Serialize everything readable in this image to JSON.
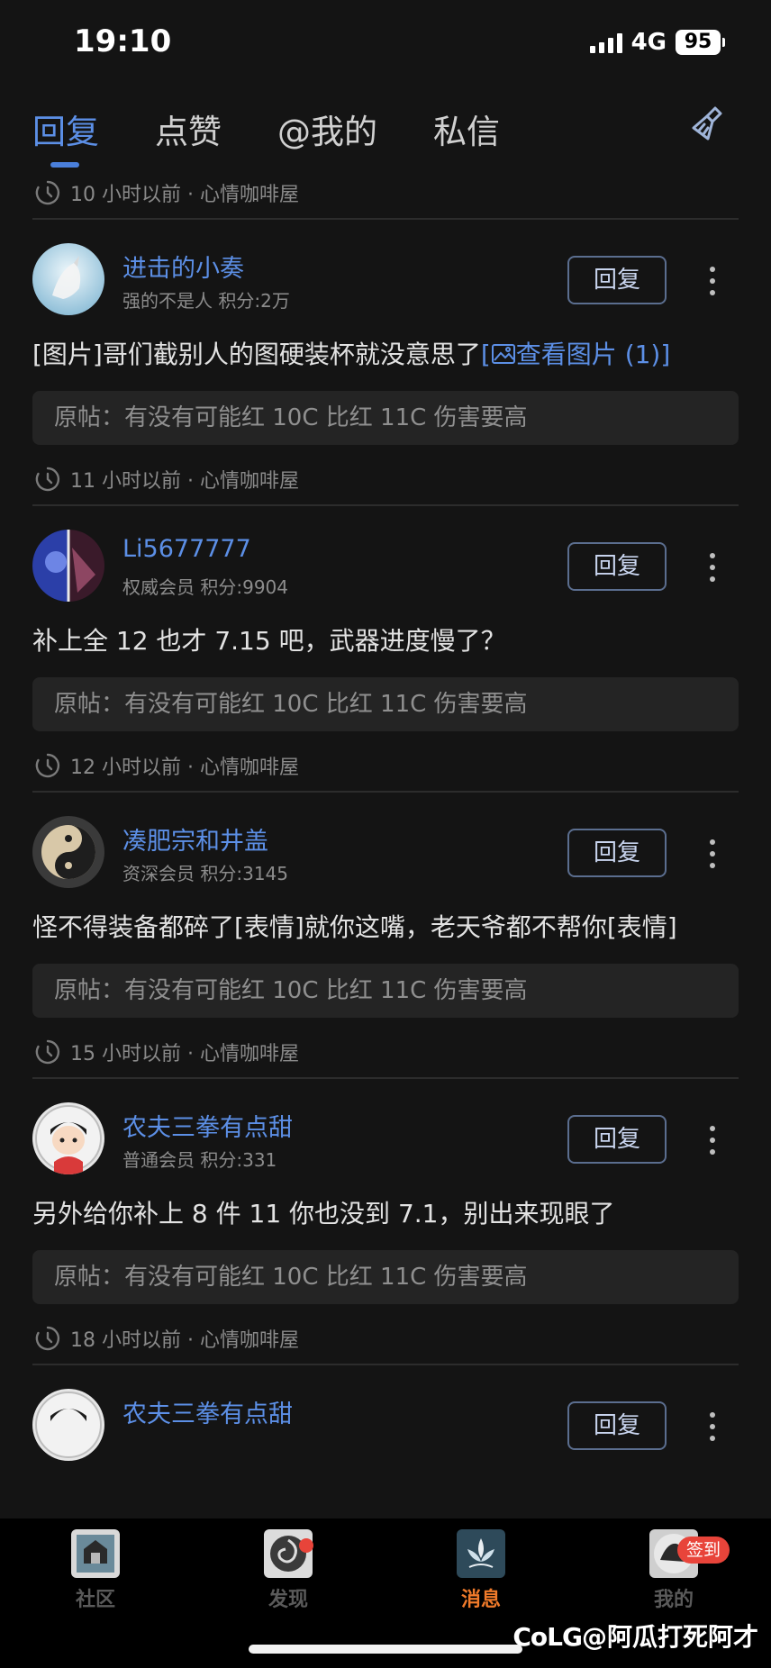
{
  "status_bar": {
    "time": "19:10",
    "network": "4G",
    "battery": "95"
  },
  "tabs": [
    {
      "label": "回复",
      "active": true
    },
    {
      "label": "点赞",
      "active": false
    },
    {
      "label": "@我的",
      "active": false
    },
    {
      "label": "私信",
      "active": false
    }
  ],
  "top_meta": {
    "time": "10 小时以前 · 心情咖啡屋"
  },
  "items": [
    {
      "username": "进击的小奏",
      "user_meta": "强的不是人 积分:2万",
      "reply_label": "回复",
      "content": "[图片]哥们截别人的图硬装杯就没意思了",
      "view_images": "查看图片 (1)]",
      "view_images_prefix": "[",
      "original": "原帖：有没有可能红 10C 比红 11C 伤害要高",
      "meta": "11 小时以前 · 心情咖啡屋",
      "avatar_colors": [
        "#cfe6f2",
        "#9fc8e0"
      ]
    },
    {
      "username": "Li5677777",
      "user_meta": "权威会员 积分:9904",
      "reply_label": "回复",
      "content": "补上全 12 也才 7.15 吧，武器进度慢了？",
      "original": "原帖：有没有可能红 10C 比红 11C 伤害要高",
      "meta": "12 小时以前 · 心情咖啡屋",
      "avatar_colors": [
        "#2a3f9a",
        "#6a2a4a"
      ]
    },
    {
      "username": "凑肥宗和井盖",
      "user_meta": "资深会员 积分:3145",
      "reply_label": "回复",
      "content": "怪不得装备都碎了[表情]就你这嘴，老天爷都不帮你[表情]",
      "original": "原帖：有没有可能红 10C 比红 11C 伤害要高",
      "meta": "15 小时以前 · 心情咖啡屋",
      "avatar_colors": [
        "#c8b89a",
        "#2a2a2a"
      ]
    },
    {
      "username": "农夫三拳有点甜",
      "user_meta": "普通会员 积分:331",
      "reply_label": "回复",
      "content": "另外给你补上 8 件 11 你也没到 7.1，别出来现眼了",
      "original": "原帖：有没有可能红 10C 比红 11C 伤害要高",
      "meta": "18 小时以前 · 心情咖啡屋",
      "avatar_colors": [
        "#e8e8e8",
        "#b0b0b0"
      ]
    },
    {
      "username": "农夫三拳有点甜",
      "user_meta": "",
      "reply_label": "回复",
      "content": "",
      "original": "",
      "meta": "",
      "avatar_colors": [
        "#e8e8e8",
        "#333333"
      ]
    }
  ],
  "bottom_nav": [
    {
      "label": "社区",
      "icon": "community-icon",
      "active": false
    },
    {
      "label": "发现",
      "icon": "discover-icon",
      "active": false,
      "dot": true
    },
    {
      "label": "消息",
      "icon": "message-icon",
      "active": true
    },
    {
      "label": "我的",
      "icon": "profile-icon",
      "active": false,
      "badge": "签到"
    }
  ],
  "watermark": {
    "logo": "CoLG",
    "text": "@阿瓜打死阿才"
  },
  "colors": {
    "accent": "#5c8fe6",
    "active_nav": "#f07a2a",
    "badge_red": "#e8443a",
    "background": "#141414"
  }
}
